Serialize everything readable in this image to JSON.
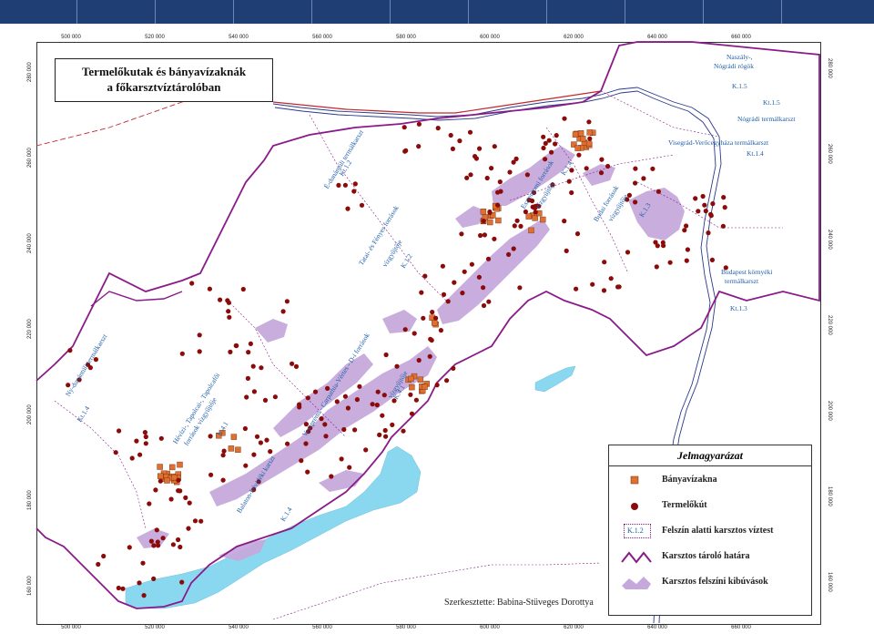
{
  "title": {
    "line1": "Termelőkutak és bányavízaknák",
    "line2": "a főkarsztvíztárolóban"
  },
  "axis_ticks": {
    "x": [
      "500 000",
      "520 000",
      "540 000",
      "560 000",
      "580 000",
      "600 000",
      "620 000",
      "640 000",
      "660 000"
    ],
    "y": [
      "280 000",
      "260 000",
      "240 000",
      "220 000",
      "200 000",
      "180 000",
      "160 000"
    ]
  },
  "region_labels": {
    "kt14": "Kt.1.4",
    "nyd": "Ny-dunántúli termálkarszt",
    "hevizi1": "Hévízi-, Tapolcai-, Tapolcafői",
    "hevizi2": "források vízgyűjtője",
    "k41": "K.4.1",
    "balaton1": "Balaton-felvidéki karszt",
    "k14b": "K.1.4",
    "bakony1": "Veszprémi - Carpathia-Vértes - D-i források",
    "bakony2": "vízgyűjtője",
    "k41b": "K.4.1",
    "tata1": "Tatai- és Fényes források",
    "tata2": "vízgyűjtője",
    "k12": "K.1.2",
    "edun": "É-dunántúli termálkarszt",
    "kt12": "Kt.1.2",
    "eszterg1": "Esztergomi források",
    "eszterg2": "vízgyűjtője",
    "k14c": "K.1.4",
    "budai1": "Budai források",
    "budai2": "vízgyűjtője",
    "k13": "K.1.3",
    "naszaly1": "Naszály-,",
    "naszaly2": "Nógrádi rögök",
    "k15": "K.1.5",
    "kt15": "Kt.1.5",
    "nograd": "Nógrádi termálkarszt",
    "visegrad": "Visegrád-Verőcegyháza termálkarszt",
    "kt14b": "Kt.1.4",
    "budapest1": "Budapest környéki",
    "budapest2": "termálkarszt",
    "kt13": "Kt.1.3"
  },
  "credit": "Szerkesztette: Babina-Stüveges Dorottya",
  "legend": {
    "title": "Jelmagyarázat",
    "items": [
      {
        "symbol": "square",
        "label": "Bányavízakna",
        "color": "#e07030"
      },
      {
        "symbol": "dot",
        "label": "Termelőkút",
        "color": "#8b0a0a"
      },
      {
        "symbol": "code",
        "code": "K.1.2",
        "label": "Felszín alatti karsztos víztest",
        "color": "#8a1a8a"
      },
      {
        "symbol": "line",
        "label": "Karsztos tároló határa",
        "color": "#7a1a7a"
      },
      {
        "symbol": "area",
        "label": "Karsztos felszíni kibúvások",
        "color": "#c6a9dc"
      }
    ]
  },
  "colors": {
    "header": "#1f3e73",
    "lake": "#8ad8f0",
    "outcrop": "#c6a9dc",
    "boundary": "#8a1a8a",
    "well": "#8b0a0a",
    "shaft": "#e07030",
    "river": "#2a3a8a",
    "label": "#1f5fa8"
  }
}
